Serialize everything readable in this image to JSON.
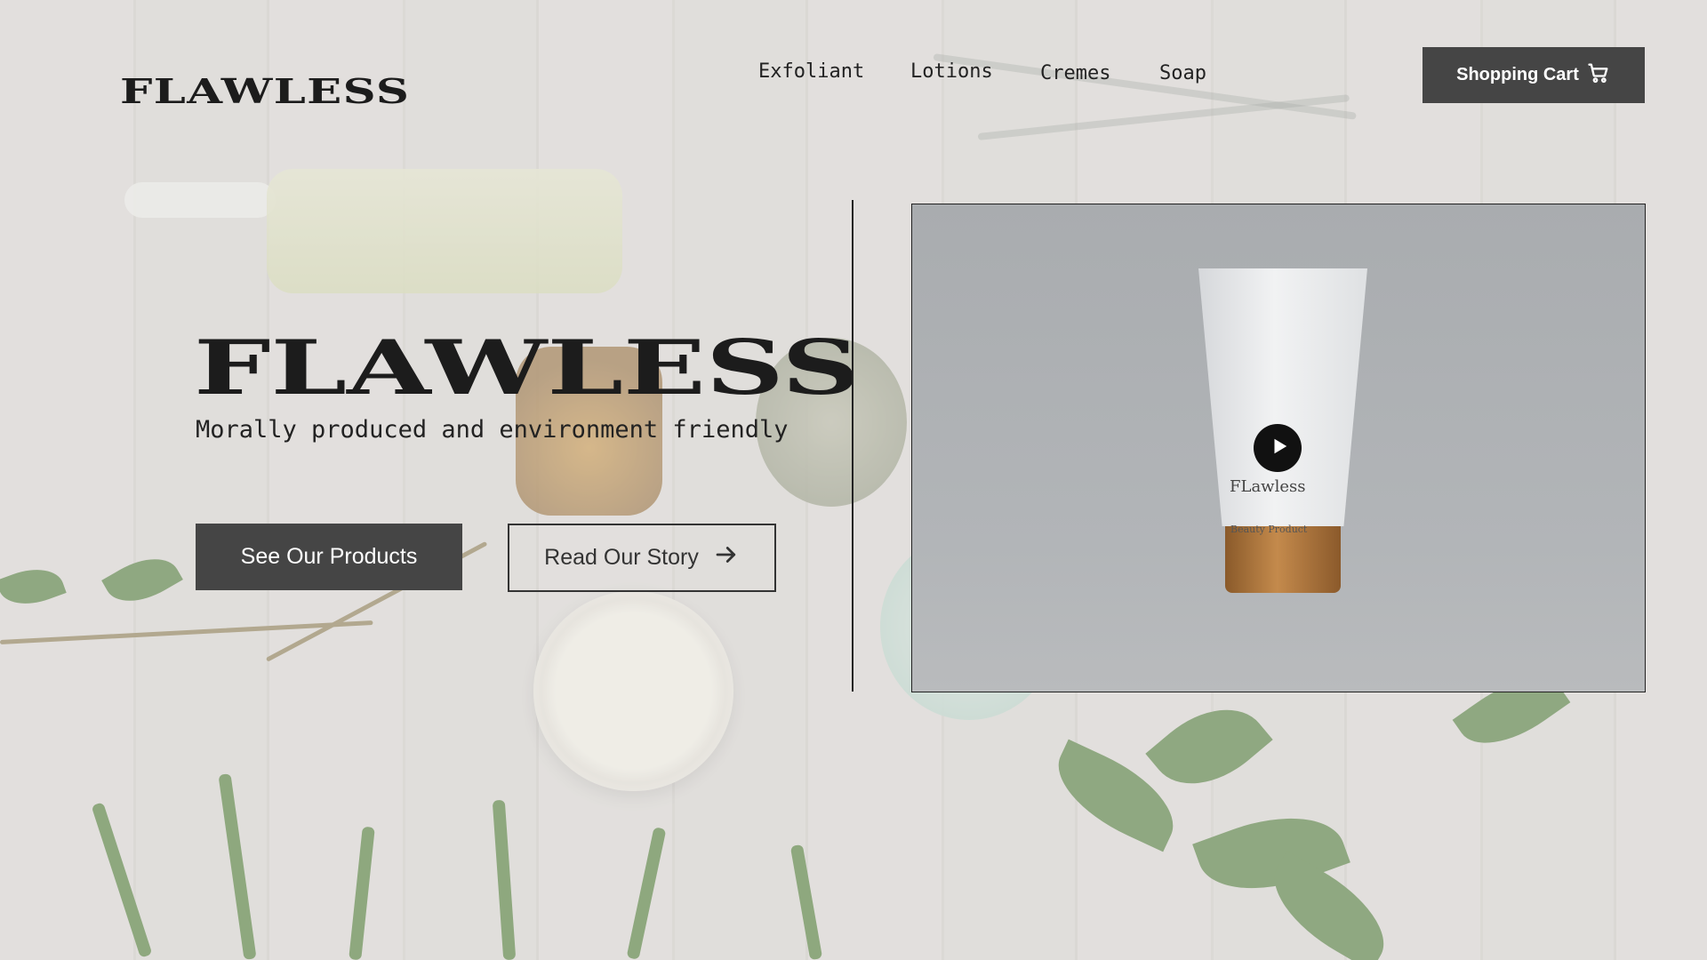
{
  "brand": {
    "logo": "FLAWLESS"
  },
  "nav": {
    "items": [
      {
        "label": "Exfoliant"
      },
      {
        "label": "Lotions"
      },
      {
        "label": "Cremes"
      },
      {
        "label": "Soap"
      }
    ]
  },
  "header": {
    "cart_label": "Shopping Cart",
    "cart_icon": "shopping-cart-icon"
  },
  "hero": {
    "title": "FLAWLESS",
    "subtitle": "Morally produced and environment friendly",
    "primary_button": "See Our Products",
    "secondary_button": "Read Our Story",
    "secondary_icon": "arrow-right-icon"
  },
  "video": {
    "play_icon": "play-icon",
    "product_brand": "FLawless",
    "product_subtitle": "Beauty Product"
  }
}
